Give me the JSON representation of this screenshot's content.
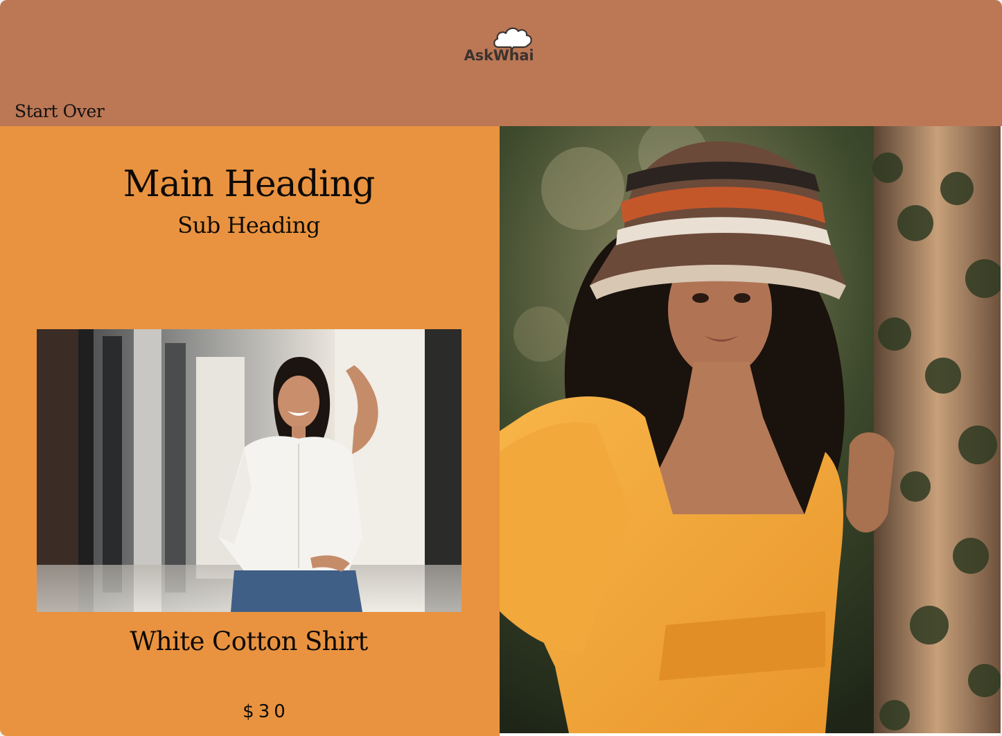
{
  "header": {
    "brand": "AskWhai",
    "logo_icon": "cloud-icon",
    "start_over_label": "Start Over",
    "background": "#bc7755"
  },
  "left_panel": {
    "background": "#e99340",
    "main_heading": "Main Heading",
    "sub_heading": "Sub Heading",
    "product": {
      "image_alt": "Woman in white cotton shirt",
      "name": "White Cotton Shirt",
      "price": "$30"
    }
  },
  "hero": {
    "image_alt": "Woman in crochet bucket hat and orange dress"
  }
}
